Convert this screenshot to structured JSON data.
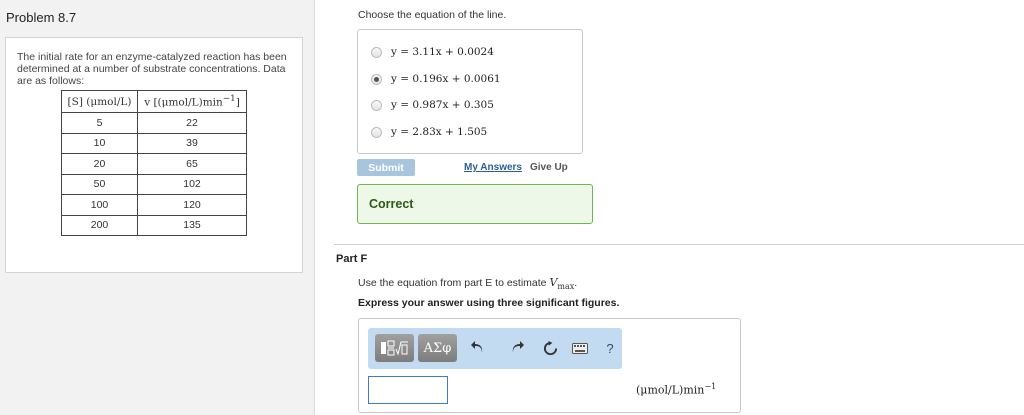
{
  "problem": {
    "title": "Problem 8.7",
    "intro": "The initial rate for an enzyme-catalyzed reaction has been determined at a number of substrate concentrations. Data are as follows:",
    "table": {
      "header_s": "[S] (μmol/L)",
      "header_v_main": "v [(μmol/L)min",
      "header_v_exp": "−1",
      "header_v_close": "]",
      "rows": [
        [
          "5",
          "22"
        ],
        [
          "10",
          "39"
        ],
        [
          "20",
          "65"
        ],
        [
          "50",
          "102"
        ],
        [
          "100",
          "120"
        ],
        [
          "200",
          "135"
        ]
      ]
    }
  },
  "part_e": {
    "prompt": "Choose the equation of the line.",
    "choices": [
      {
        "label": "y = 3.11x + 0.0024",
        "selected": false
      },
      {
        "label": "y = 0.196x + 0.0061",
        "selected": true
      },
      {
        "label": "y = 0.987x + 0.305",
        "selected": false
      },
      {
        "label": "y = 2.83x + 1.505",
        "selected": false
      }
    ],
    "submit_label": "Submit",
    "my_answers_label": "My Answers",
    "give_up_label": "Give Up",
    "feedback": "Correct"
  },
  "part_f": {
    "title": "Part F",
    "instruction_prefix": "Use the equation from part E to estimate",
    "vmax_symbol": "V",
    "vmax_sub": "max",
    "instruction_suffix": ".",
    "express": "Express your answer using three significant figures.",
    "toolbar": {
      "templates_icon": "fraction-sqrt-template-icon",
      "symbols_label": "ΑΣφ",
      "undo_icon": "undo-icon",
      "redo_icon": "redo-icon",
      "reset_icon": "reset-icon",
      "keyboard_icon": "keyboard-icon",
      "help_label": "?"
    },
    "answer_value": "",
    "unit_main": "(μmol/L)min",
    "unit_exp": "−1"
  },
  "colors": {
    "correct_border": "#6cb84f",
    "correct_bg": "#eef8e9",
    "submit_bg": "#a8c5de",
    "toolbar_bg": "#c2dbf1",
    "link": "#2d5f97"
  }
}
